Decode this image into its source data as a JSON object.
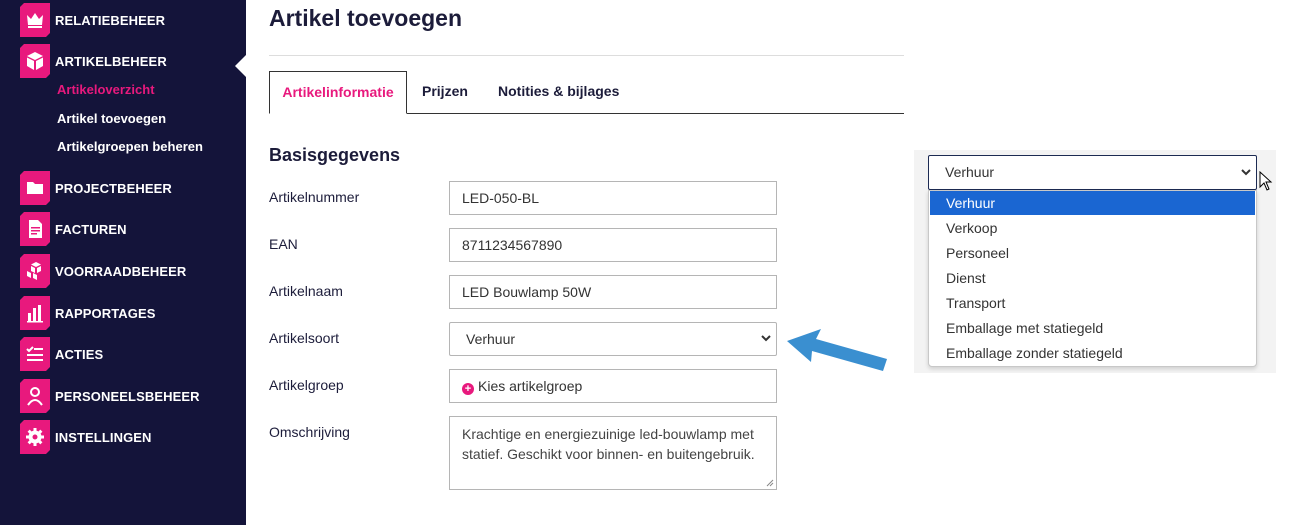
{
  "colors": {
    "sidebar_bg": "#14143a",
    "accent": "#e8197d",
    "selected_option": "#1a66d2",
    "arrow": "#3a8fd0"
  },
  "sidebar": {
    "items": [
      {
        "label": "RELATIEBEHEER",
        "icon": "crown-icon"
      },
      {
        "label": "ARTIKELBEHEER",
        "icon": "box-icon",
        "subitems": [
          {
            "label": "Artikeloverzicht",
            "active": true
          },
          {
            "label": "Artikel toevoegen"
          },
          {
            "label": "Artikelgroepen beheren"
          }
        ]
      },
      {
        "label": "PROJECTBEHEER",
        "icon": "folder-icon"
      },
      {
        "label": "FACTUREN",
        "icon": "document-icon"
      },
      {
        "label": "VOORRAADBEHEER",
        "icon": "boxes-icon"
      },
      {
        "label": "RAPPORTAGES",
        "icon": "bar-chart-icon"
      },
      {
        "label": "ACTIES",
        "icon": "checklist-icon"
      },
      {
        "label": "PERSONEELSBEHEER",
        "icon": "person-icon"
      },
      {
        "label": "INSTELLINGEN",
        "icon": "gear-icon"
      }
    ]
  },
  "main": {
    "title": "Artikel toevoegen",
    "tabs": [
      {
        "label": "Artikelinformatie",
        "active": true
      },
      {
        "label": "Prijzen"
      },
      {
        "label": "Notities & bijlages"
      }
    ],
    "section_title": "Basisgegevens",
    "fields": {
      "artikelnummer": {
        "label": "Artikelnummer",
        "value": "LED-050-BL"
      },
      "ean": {
        "label": "EAN",
        "value": "8711234567890"
      },
      "artikelnaam": {
        "label": "Artikelnaam",
        "value": "LED Bouwlamp 50W"
      },
      "artikelsoort": {
        "label": "Artikelsoort",
        "value": "Verhuur"
      },
      "artikelgroep": {
        "label": "Artikelgroep",
        "value": "Kies artikelgroep"
      },
      "omschrijving": {
        "label": "Omschrijving",
        "value": "Krachtige en energiezuinige led-bouwlamp met statief. Geschikt voor binnen- en buitengebruik."
      }
    }
  },
  "dropdown": {
    "selected": "Verhuur",
    "options": [
      "Verhuur",
      "Verkoop",
      "Personeel",
      "Dienst",
      "Transport",
      "Emballage met statiegeld",
      "Emballage zonder statiegeld"
    ]
  }
}
